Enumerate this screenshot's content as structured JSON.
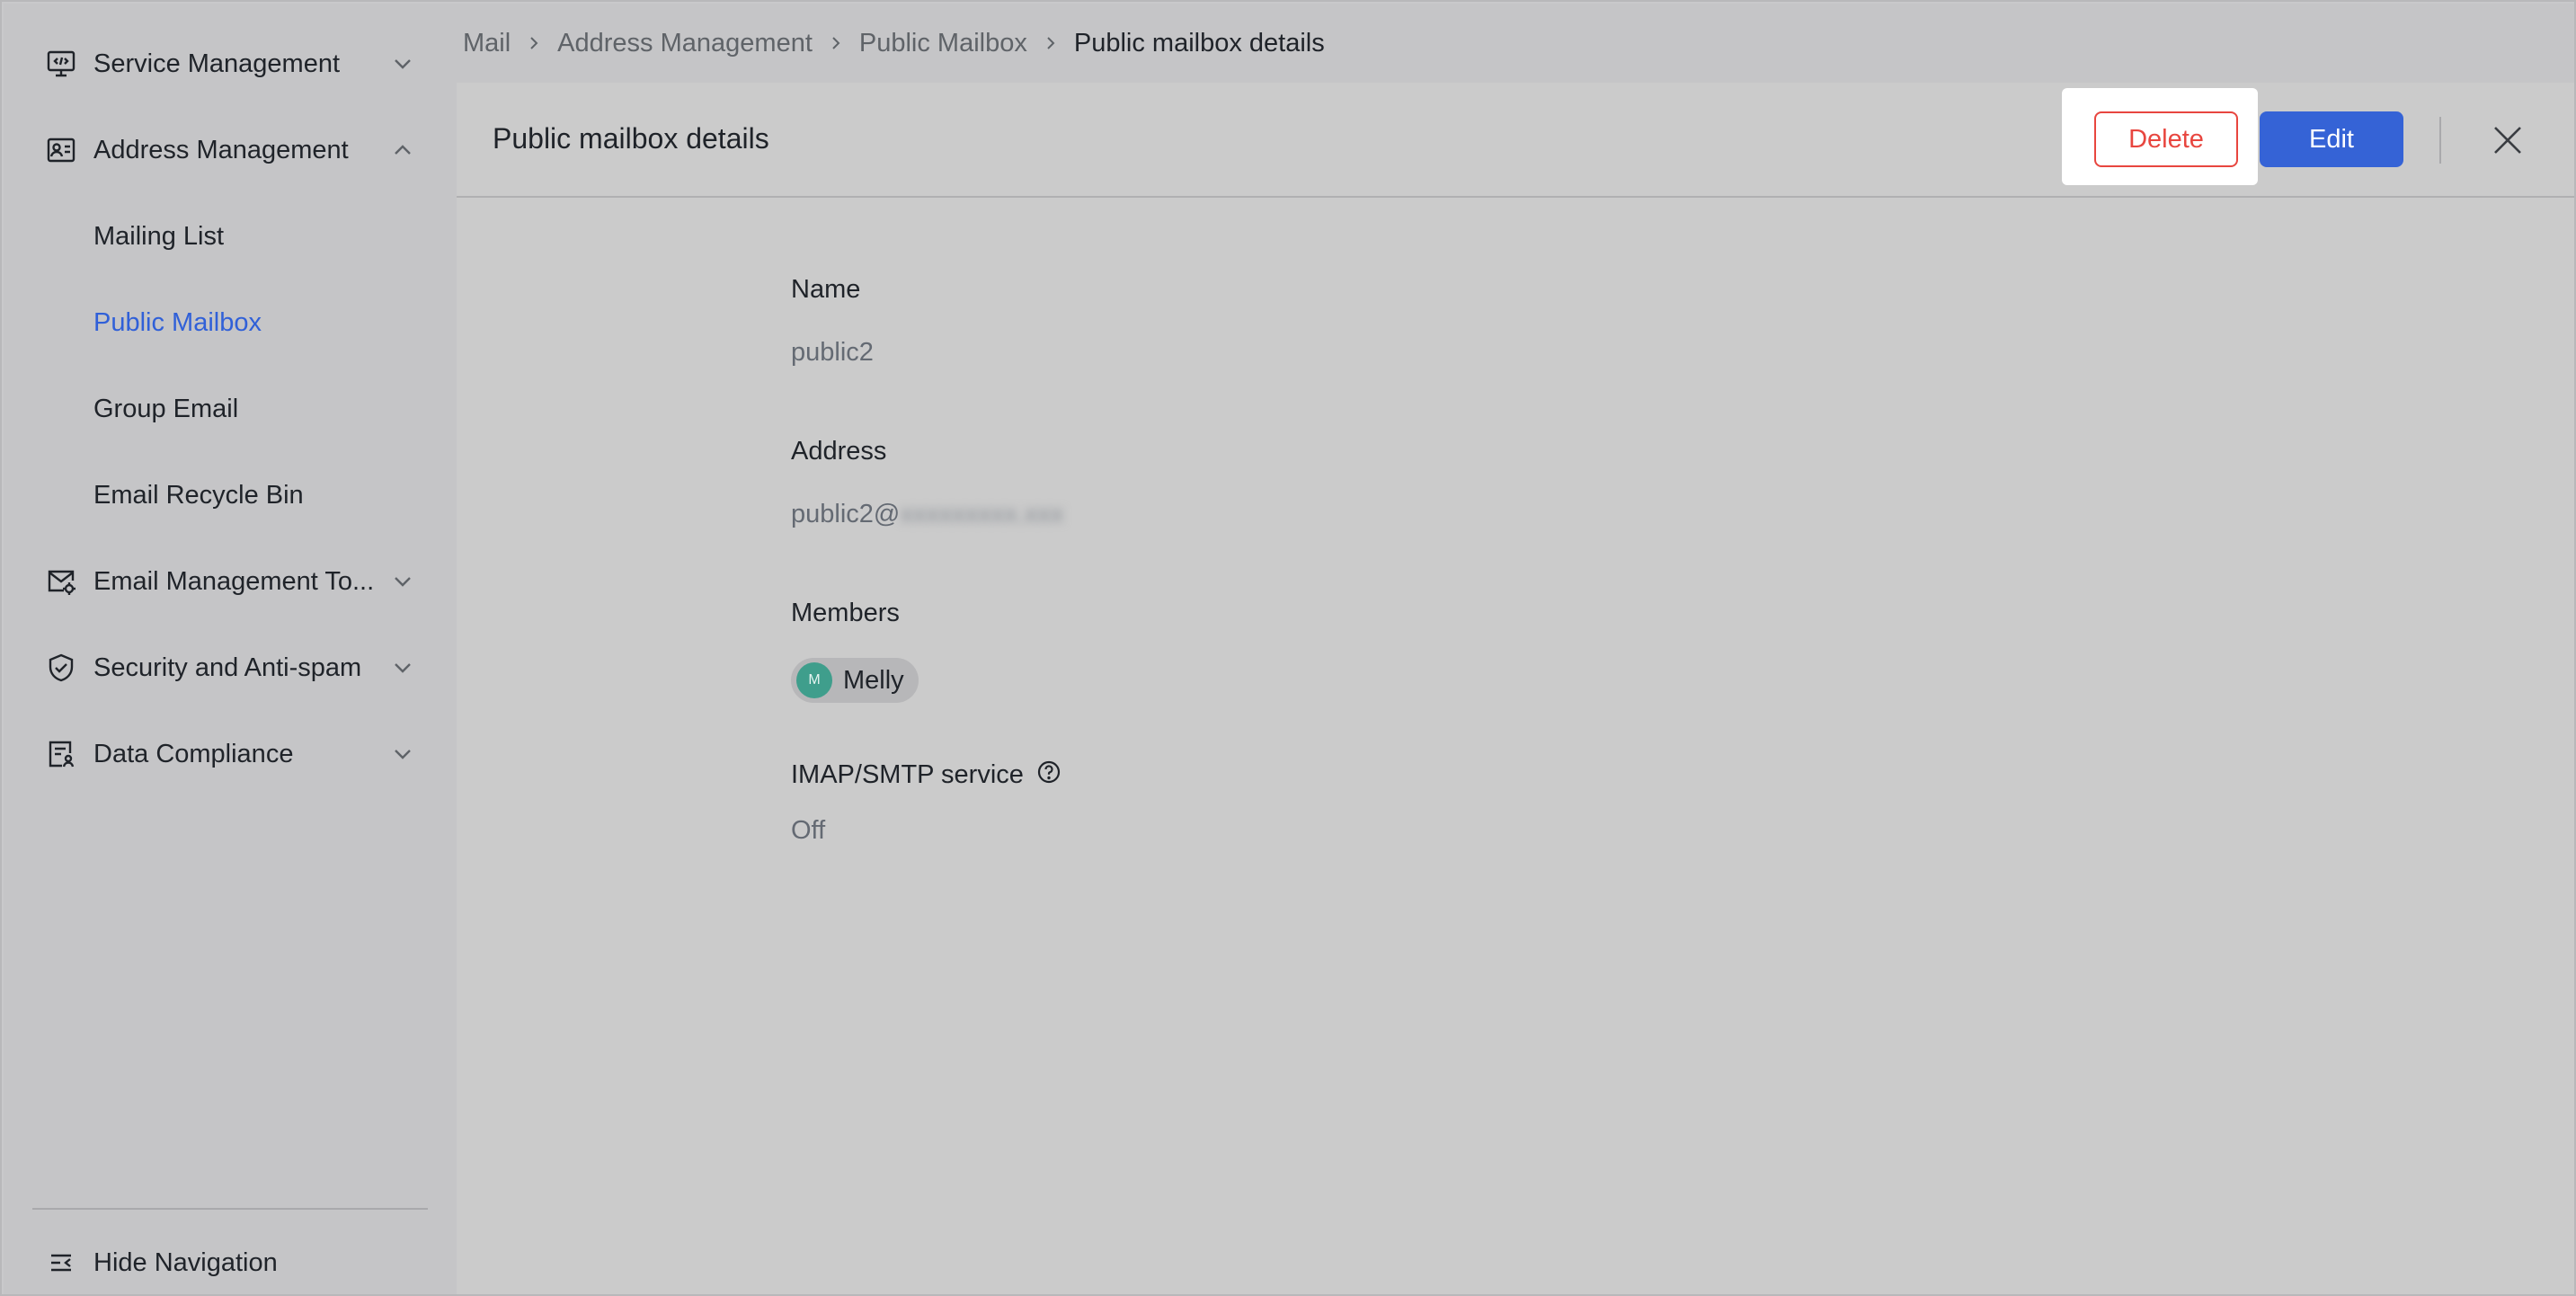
{
  "sidebar": {
    "items": [
      {
        "label": "Service Management",
        "icon": "monitor-code-icon",
        "expanded": false
      },
      {
        "label": "Address Management",
        "icon": "contact-card-icon",
        "expanded": true
      },
      {
        "label": "Mailing List",
        "sub": true
      },
      {
        "label": "Public Mailbox",
        "sub": true,
        "active": true
      },
      {
        "label": "Group Email",
        "sub": true
      },
      {
        "label": "Email Recycle Bin",
        "sub": true
      },
      {
        "label": "Email Management To...",
        "icon": "mail-settings-icon",
        "expanded": false
      },
      {
        "label": "Security and Anti-spam",
        "icon": "shield-check-icon",
        "expanded": false
      },
      {
        "label": "Data Compliance",
        "icon": "document-user-icon",
        "expanded": false
      }
    ],
    "hide_nav_label": "Hide Navigation",
    "active_color": "#3060d8"
  },
  "breadcrumb": [
    "Mail",
    "Address Management",
    "Public Mailbox",
    "Public mailbox details"
  ],
  "panel": {
    "title": "Public mailbox details",
    "delete_label": "Delete",
    "edit_label": "Edit",
    "delete_color": "#e8463f",
    "edit_color": "#3563d6"
  },
  "details": {
    "name_label": "Name",
    "name_value": "public2",
    "address_label": "Address",
    "address_value": "public2@",
    "address_domain_redacted": "xxxxxxxxx.xxx",
    "members_label": "Members",
    "members": [
      {
        "initial": "M",
        "name": "Melly"
      }
    ],
    "imap_label": "IMAP/SMTP service",
    "imap_value": "Off"
  }
}
